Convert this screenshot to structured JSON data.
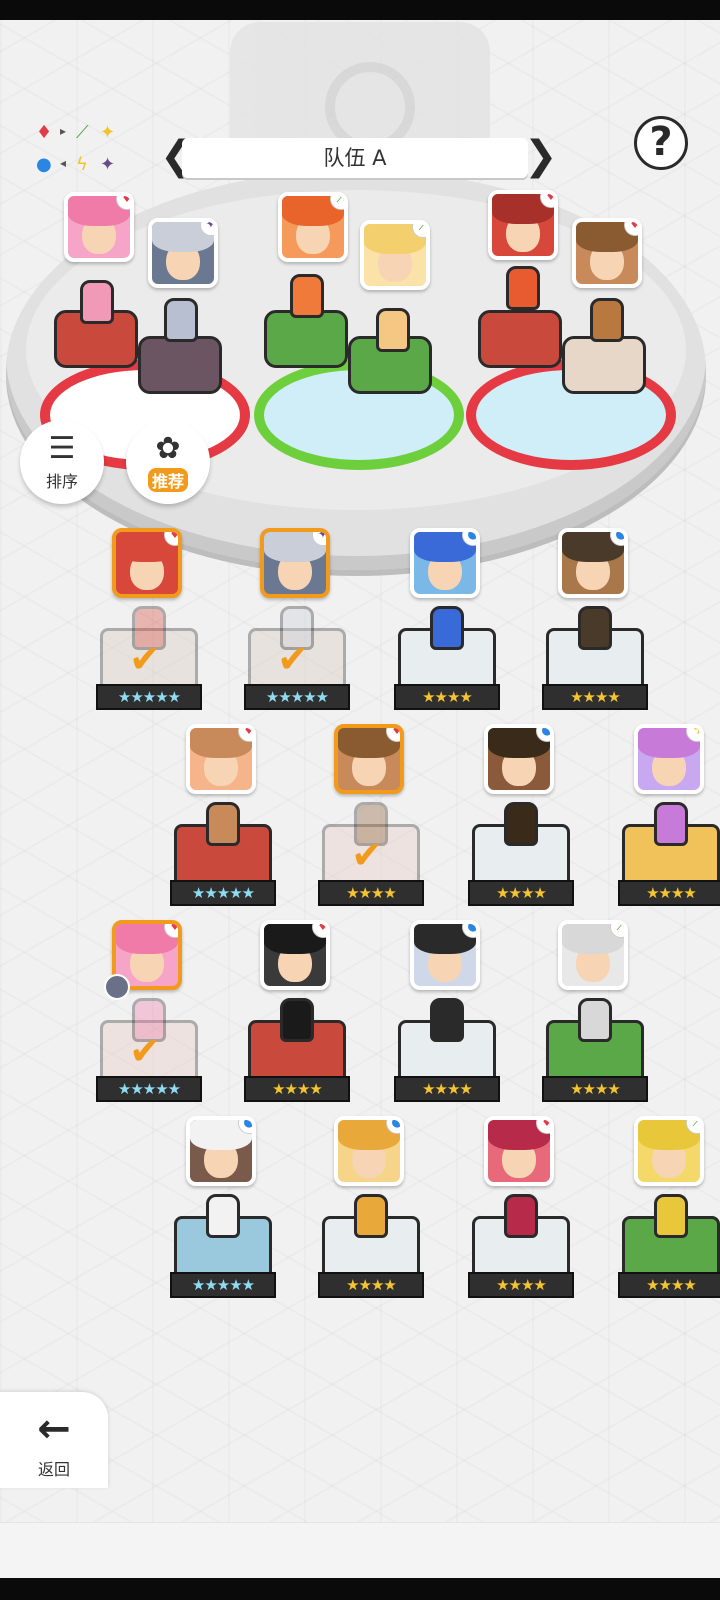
{
  "team": {
    "name": "队伍 A",
    "prev_label": "❮",
    "next_label": "❯"
  },
  "help": {
    "label": "?"
  },
  "element_chart": {
    "icons": [
      "♦",
      "▸",
      "⟋",
      "✦",
      "●",
      "◂",
      "ϟ",
      "✦"
    ]
  },
  "buttons": {
    "sort": {
      "icon": "☰",
      "label": "排序"
    },
    "recommend": {
      "icon": "✿",
      "label": "推荐"
    },
    "back": {
      "icon": "←",
      "label": "返回"
    }
  },
  "colors": {
    "accent_orange": "#f29a1b",
    "red": "#e23b47",
    "green": "#6ecf3c",
    "blue": "#2a86e4"
  },
  "stage_slots": [
    {
      "element": "♦",
      "element_color": "red"
    },
    {
      "element": "✦",
      "element_color": "purple"
    },
    {
      "element": "⟋",
      "element_color": "green"
    },
    {
      "element": "⟋",
      "element_color": "green"
    },
    {
      "element": "♦",
      "element_color": "red"
    },
    {
      "element": "♦",
      "element_color": "red"
    }
  ],
  "roster": [
    {
      "element": "♦",
      "stars": "★★★★★",
      "rarity": 5,
      "selected": true
    },
    {
      "element": "✦",
      "stars": "★★★★★",
      "rarity": 5,
      "selected": true
    },
    {
      "element": "●",
      "stars": "★★★★",
      "rarity": 4,
      "selected": false
    },
    {
      "element": "●",
      "stars": "★★★★",
      "rarity": 4,
      "selected": false
    },
    {
      "element": "♦",
      "stars": "★★★★★",
      "rarity": 5,
      "selected": false
    },
    {
      "element": "♦",
      "stars": "★★★★",
      "rarity": 4,
      "selected": true
    },
    {
      "element": "●",
      "stars": "★★★★",
      "rarity": 4,
      "selected": false
    },
    {
      "element": "ϟ",
      "stars": "★★★★",
      "rarity": 4,
      "selected": false
    },
    {
      "element": "♦",
      "stars": "★★★★★",
      "rarity": 5,
      "selected": true
    },
    {
      "element": "♦",
      "stars": "★★★★",
      "rarity": 4,
      "selected": false
    },
    {
      "element": "●",
      "stars": "★★★★",
      "rarity": 4,
      "selected": false
    },
    {
      "element": "⟋",
      "stars": "★★★★",
      "rarity": 4,
      "selected": false
    },
    {
      "element": "●",
      "stars": "★★★★★",
      "rarity": 5,
      "selected": false
    },
    {
      "element": "●",
      "stars": "★★★★",
      "rarity": 4,
      "selected": false
    },
    {
      "element": "♦",
      "stars": "★★★★",
      "rarity": 4,
      "selected": false
    },
    {
      "element": "⟋",
      "stars": "★★★★",
      "rarity": 4,
      "selected": false
    }
  ],
  "selected_mark": "✔"
}
